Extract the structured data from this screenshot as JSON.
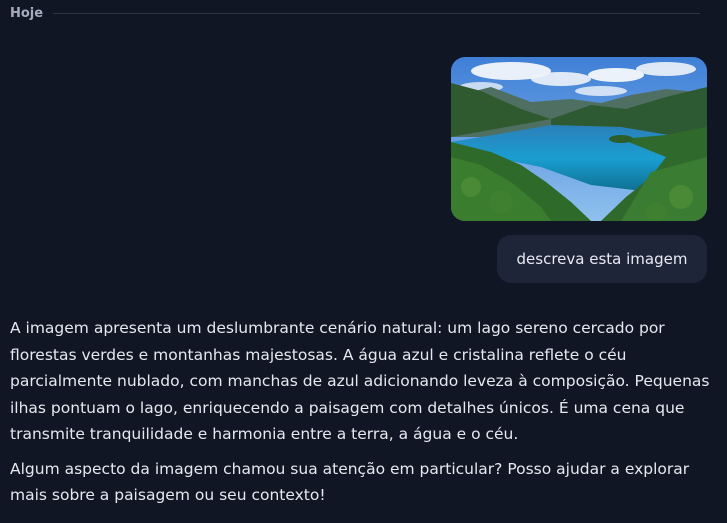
{
  "conversation": {
    "date_label": "Hoje",
    "user_message": {
      "image_icon": "landscape-photo",
      "text": "descreva esta imagem"
    },
    "assistant_message": {
      "paragraphs": [
        "A imagem apresenta um deslumbrante cenário natural: um lago sereno cercado por florestas verdes e montanhas majestosas. A água azul e cristalina reflete o céu parcialmente nublado, com manchas de azul adicionando leveza à composição. Pequenas ilhas pontuam o lago, enriquecendo a paisagem com detalhes únicos. É uma cena que transmite tranquilidade e harmonia entre a terra, a água e o céu.",
        "Algum aspecto da imagem chamou sua atenção em particular? Posso ajudar a explorar mais sobre a paisagem ou seu contexto!"
      ]
    }
  },
  "colors": {
    "background": "#111625",
    "user_bubble": "#1f2538",
    "text": "#e6e8ef",
    "muted": "#a7acbd"
  }
}
